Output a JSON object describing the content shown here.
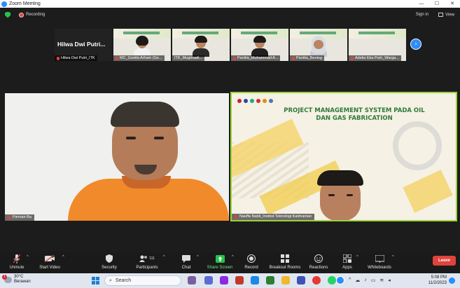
{
  "window": {
    "title": "Zoom Meeting",
    "controls": [
      "—",
      "☐",
      "✕"
    ]
  },
  "topbar": {
    "recording_label": "Recording",
    "sign_in_label": "Sign in",
    "view_label": "View"
  },
  "gallery": {
    "tiles": [
      {
        "big_name": "Hilwa Dwi Putri...",
        "label": "Hilwa Dwi Putri_ITK",
        "muted": true
      },
      {
        "label": "MC_Gonita Arham (Ge...",
        "muted": true
      },
      {
        "label": "ITK_Mugimadi...",
        "muted": false
      },
      {
        "label": "Panitia_Muhammad A...",
        "muted": true
      },
      {
        "label": "Panitia_Bening",
        "muted": true
      },
      {
        "label": "Adelia Eka Putri_Warga...",
        "muted": true
      }
    ],
    "next_icon": "chevron-right-icon"
  },
  "main_videos": {
    "left_label": "Fiernan Ba",
    "right_label": "Nauffa Nabil_Institut Teknologi Kalimantan",
    "slide_title_line1": "PROJECT MANAGEMENT SYSTEM PADA OIL",
    "slide_title_line2": "DAN GAS FABRICATION"
  },
  "toolbar": {
    "unmute": "Unmute",
    "start_video": "Start Video",
    "security": "Security",
    "participants": "Participants",
    "participants_count": "111",
    "chat": "Chat",
    "share_screen": "Share Screen",
    "record": "Record",
    "breakout_rooms": "Breakout Rooms",
    "reactions": "Reactions",
    "apps": "Apps",
    "whiteboards": "Whiteboards",
    "leave": "Leave",
    "share_color": "#27c24c",
    "leave_color": "#e0433b"
  },
  "taskbar": {
    "weather_badge": "1",
    "weather_temp": "30°C",
    "weather_desc": "Berawan",
    "search_placeholder": "Search",
    "time": "5:08 PM",
    "date": "11/2/2023"
  }
}
